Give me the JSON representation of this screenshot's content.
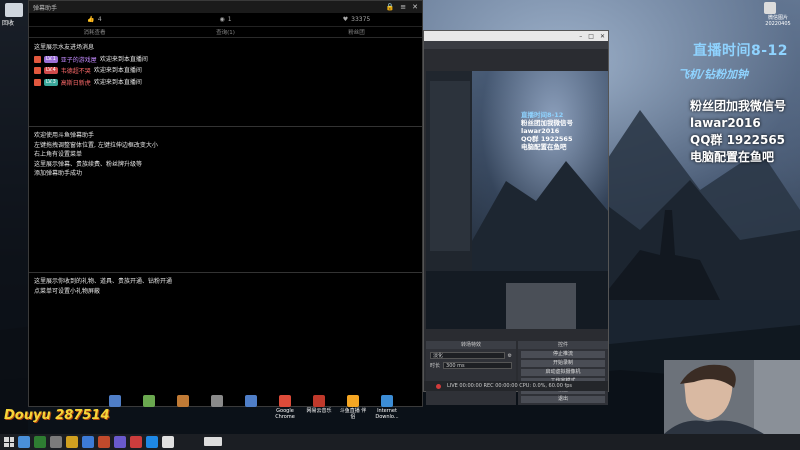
{
  "helper_window": {
    "title": "弹幕助手",
    "stats": [
      {
        "icon": "thumb-up-icon",
        "value": "4"
      },
      {
        "icon": "fish-ball-icon",
        "value": "1"
      },
      {
        "icon": "heart-icon",
        "value": "33375"
      }
    ],
    "tabs": [
      "消耗查看",
      "查询(1)",
      "粉丝团"
    ],
    "section_entry": {
      "intro": "这里展示水友进场消息",
      "messages": [
        {
          "level": "LV.1",
          "level_color": "#9b6fd6",
          "user": "亚子的游戏屋",
          "user_color": "#c48bff",
          "text": "欢迎来到本直播间"
        },
        {
          "level": "LV.4",
          "level_color": "#d04a4a",
          "user": "韦德超不哭",
          "user_color": "#ff6b6b",
          "text": "欢迎来到本直播间"
        },
        {
          "level": "LV.3",
          "level_color": "#3aa79a",
          "user": "高斯日新虎",
          "user_color": "#ff6b6b",
          "text": "欢迎来到本直播间"
        }
      ]
    },
    "section_help": {
      "lines": [
        "欢迎使用斗鱼弹幕助手",
        "左键拖拽调整窗体位置, 左键拉伸边框改变大小",
        "右上角有设置菜单",
        "这里展示弹幕、贵族续费、粉丝牌升级等",
        "添加弹幕助手成功"
      ]
    },
    "section_gift": {
      "lines": [
        "这里展示你收到的礼物、道具、贵族开通、钻粉开通",
        "点菜单可设置小礼物屏蔽"
      ]
    }
  },
  "obs_window": {
    "overlay_lines": [
      "直播时间8-12",
      "粉丝团加我微信号",
      "lawar2016",
      "QQ群 1922565",
      "电脑配置在鱼吧"
    ],
    "scene_panel_title": "转场特效",
    "scene_select": "淡化",
    "duration_label": "时长",
    "duration_value": "300 ms",
    "controls_title": "控件",
    "control_buttons": [
      "停止推流",
      "开始录制",
      "启动虚拟摄像机",
      "工作室模式",
      "设置",
      "退出"
    ],
    "status_text": "LIVE 00:00:00   REC 00:00:00   CPU: 0.0%, 60.00 fps"
  },
  "stream_overlay": {
    "time_text": "直播时间8-12",
    "sub_text": "飞机/钻粉加钟",
    "info_lines": [
      "粉丝团加我微信号",
      "lawar2016",
      "QQ群 1922565",
      "电脑配置在鱼吧"
    ]
  },
  "desktop": {
    "recycle_label": "回收",
    "top_right_label": "微信图片\n20220405",
    "icons": [
      {
        "label": "",
        "color": "#4f7ec7"
      },
      {
        "label": "",
        "color": "#6aa84f"
      },
      {
        "label": "",
        "color": "#c07a35"
      },
      {
        "label": "",
        "color": "#8a8a8a"
      },
      {
        "label": "",
        "color": "#4f7ec7"
      },
      {
        "label": "Google Chrome",
        "color": "#dd4b39"
      },
      {
        "label": "网易云音乐",
        "color": "#c0392b"
      },
      {
        "label": "斗鱼直播 伴侣",
        "color": "#f5a623"
      },
      {
        "label": "Internet Downlo...",
        "color": "#3c8dd6"
      }
    ]
  },
  "watermark": {
    "brand": "Douyu",
    "room": "287514"
  },
  "taskbar": {
    "apps": [
      "#4a90d9",
      "#2e7d32",
      "#7b7b7b",
      "#d0a020",
      "#3d7bd6",
      "#c24a2c",
      "#6a5acd",
      "#cc3d3d",
      "#1e88e5",
      "#e0e0e0"
    ]
  }
}
